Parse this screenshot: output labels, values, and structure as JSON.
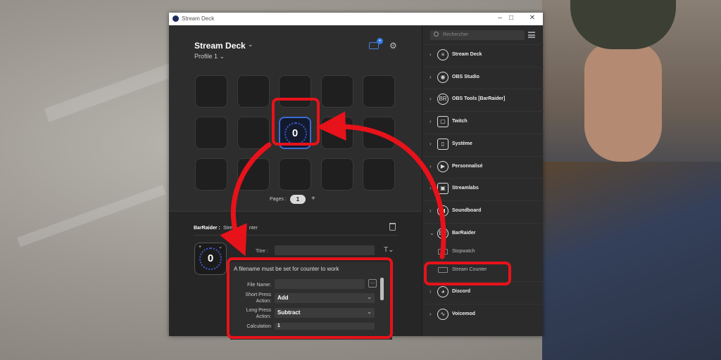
{
  "window": {
    "title": "Stream Deck"
  },
  "device": {
    "name": "Stream Deck",
    "profile": "Profile 1"
  },
  "grid": {
    "active_value": "0"
  },
  "pages": {
    "label": "Pages :",
    "current": "1",
    "add": "+"
  },
  "action": {
    "plugin": "BarRaider :",
    "name_visible": "Stre",
    "name_rest": "nter"
  },
  "properties": {
    "key_value": "0",
    "title_label": "Titre :",
    "warning": "A filename must be set for counter to work",
    "file_name_label": "File Name:",
    "browse": "...",
    "short_press_label": "Short Press Action:",
    "short_press_value": "Add",
    "long_press_label": "Long Press Action:",
    "long_press_value": "Subtract",
    "calculation_label": "Calculation",
    "calculation_value": "1"
  },
  "search": {
    "placeholder": "Rechercher"
  },
  "categories": [
    {
      "label": "Stream Deck",
      "icon": "stream-deck-icon"
    },
    {
      "label": "OBS Studio",
      "icon": "obs-icon"
    },
    {
      "label": "OBS Tools [BarRaider]",
      "icon": "obs-tools-icon"
    },
    {
      "label": "Twitch",
      "icon": "twitch-icon"
    },
    {
      "label": "Système",
      "icon": "system-icon"
    },
    {
      "label": "Personnalisé",
      "icon": "custom-icon"
    },
    {
      "label": "Streamlabs",
      "icon": "streamlabs-icon"
    },
    {
      "label": "Soundboard",
      "icon": "soundboard-icon"
    },
    {
      "label": "BarRaider",
      "icon": "barraider-icon"
    }
  ],
  "barraider_actions": [
    {
      "label": "Stopwatch"
    },
    {
      "label": "Stream Counter"
    }
  ],
  "categories_after": [
    {
      "label": "Discord",
      "icon": "discord-icon"
    },
    {
      "label": "Voicemod",
      "icon": "voicemod-icon"
    }
  ],
  "colors": {
    "highlight": "#e8121a",
    "accent": "#3c6bd6"
  }
}
